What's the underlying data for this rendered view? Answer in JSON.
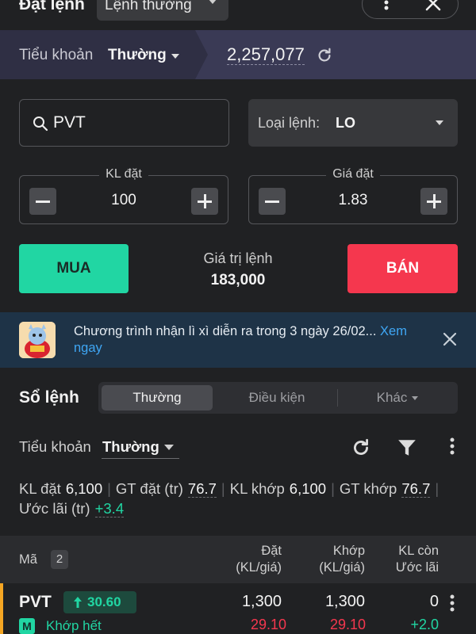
{
  "header": {
    "title": "Đặt lệnh",
    "order_mode": "Lệnh thường"
  },
  "account": {
    "label": "Tiểu khoản",
    "value": "Thường",
    "balance": "2,257,077"
  },
  "search": {
    "symbol": "PVT"
  },
  "order_type": {
    "label": "Loại lệnh:",
    "value": "LO"
  },
  "quantity": {
    "label": "KL đặt",
    "value": "100"
  },
  "price": {
    "label": "Giá đặt",
    "value": "1.83"
  },
  "actions": {
    "buy": "MUA",
    "sell": "BÁN"
  },
  "order_value": {
    "label": "Giá trị lệnh",
    "value": "183,000"
  },
  "promo": {
    "text": "Chương trình nhận lì xì diễn ra trong 3 ngày 26/02...",
    "link": "Xem ngay"
  },
  "order_book": {
    "title": "Sổ lệnh",
    "tabs": [
      "Thường",
      "Điều kiện",
      "Khác"
    ],
    "active_tab": "Thường",
    "sub_label": "Tiểu khoản",
    "sub_value": "Thường",
    "summary": {
      "kl_dat_label": "KL đặt",
      "kl_dat": "6,100",
      "gt_dat_label": "GT đặt (tr)",
      "gt_dat": "76.7",
      "kl_khop_label": "KL khớp",
      "kl_khop": "6,100",
      "gt_khop_label": "GT khớp",
      "gt_khop": "76.7",
      "uoc_lai_label": "Ước lãi (tr)",
      "uoc_lai": "+3.4"
    },
    "columns": {
      "ma": "Mã",
      "count": "2",
      "dat_1": "Đặt",
      "dat_2": "(KL/giá)",
      "khop_1": "Khớp",
      "khop_2": "(KL/giá)",
      "con_1": "KL còn",
      "con_2": "Ước lãi"
    },
    "rows": [
      {
        "symbol": "PVT",
        "change": "30.60",
        "status_code": "M",
        "status": "Khớp hết",
        "dat_kl": "1,300",
        "dat_gia": "29.10",
        "khop_kl": "1,300",
        "khop_gia": "29.10",
        "con_kl": "0",
        "uoc_lai": "+2.0"
      }
    ]
  },
  "colors": {
    "buy": "#21d6a3",
    "sell": "#f5374e",
    "background": "#202123",
    "link": "#3fa7f5",
    "accent": "#f5a623"
  }
}
